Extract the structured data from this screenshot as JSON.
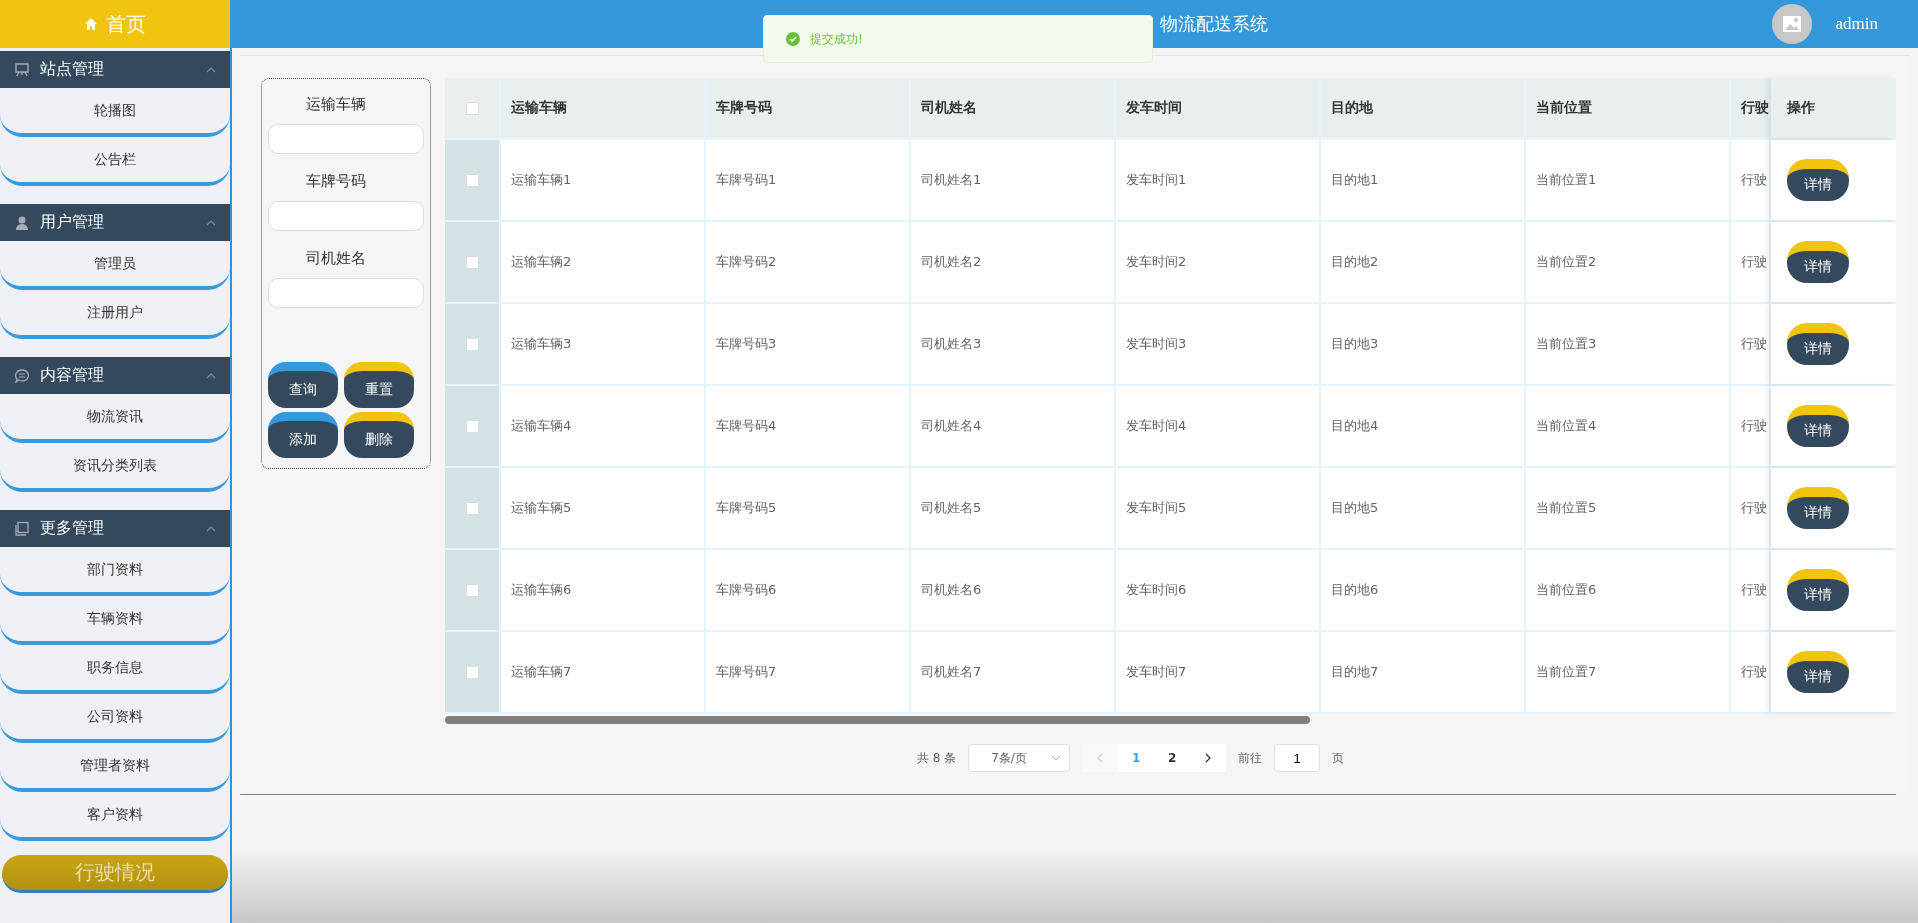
{
  "header": {
    "home": "首页",
    "title": "物流配送系统",
    "user": "admin"
  },
  "toast": {
    "message": "提交成功!"
  },
  "sidebar": {
    "groups": [
      {
        "title": "站点管理",
        "expanded": true,
        "items": [
          "轮播图",
          "公告栏"
        ]
      },
      {
        "title": "用户管理",
        "expanded": true,
        "items": [
          "管理员",
          "注册用户"
        ]
      },
      {
        "title": "内容管理",
        "expanded": true,
        "items": [
          "物流资讯",
          "资讯分类列表"
        ]
      },
      {
        "title": "更多管理",
        "expanded": true,
        "items": [
          "部门资料",
          "车辆资料",
          "职务信息",
          "公司资料",
          "管理者资料",
          "客户资料"
        ]
      }
    ],
    "footer_button": "行驶情况"
  },
  "filters": [
    {
      "label": "运输车辆"
    },
    {
      "label": "车牌号码"
    },
    {
      "label": "司机姓名"
    }
  ],
  "filter_buttons": [
    {
      "label": "查询",
      "color": "#3498db"
    },
    {
      "label": "重置",
      "color": "#f1c40f"
    },
    {
      "label": "添加",
      "color": "#3498db"
    },
    {
      "label": "删除",
      "color": "#f1c40f"
    }
  ],
  "table": {
    "columns": [
      "运输车辆",
      "车牌号码",
      "司机姓名",
      "发车时间",
      "目的地",
      "当前位置",
      "行驶"
    ],
    "action_column": "操作",
    "all_checked": false,
    "rows": [
      {
        "checked": false,
        "cells": [
          "运输车辆1",
          "车牌号码1",
          "司机姓名1",
          "发车时间1",
          "目的地1",
          "当前位置1",
          "行驶"
        ],
        "action": "详情"
      },
      {
        "checked": false,
        "cells": [
          "运输车辆2",
          "车牌号码2",
          "司机姓名2",
          "发车时间2",
          "目的地2",
          "当前位置2",
          "行驶"
        ],
        "action": "详情"
      },
      {
        "checked": false,
        "cells": [
          "运输车辆3",
          "车牌号码3",
          "司机姓名3",
          "发车时间3",
          "目的地3",
          "当前位置3",
          "行驶"
        ],
        "action": "详情"
      },
      {
        "checked": false,
        "cells": [
          "运输车辆4",
          "车牌号码4",
          "司机姓名4",
          "发车时间4",
          "目的地4",
          "当前位置4",
          "行驶"
        ],
        "action": "详情"
      },
      {
        "checked": false,
        "cells": [
          "运输车辆5",
          "车牌号码5",
          "司机姓名5",
          "发车时间5",
          "目的地5",
          "当前位置5",
          "行驶"
        ],
        "action": "详情"
      },
      {
        "checked": false,
        "cells": [
          "运输车辆6",
          "车牌号码6",
          "司机姓名6",
          "发车时间6",
          "目的地6",
          "当前位置6",
          "行驶"
        ],
        "action": "详情"
      },
      {
        "checked": false,
        "cells": [
          "运输车辆7",
          "车牌号码7",
          "司机姓名7",
          "发车时间7",
          "目的地7",
          "当前位置7",
          "行驶"
        ],
        "action": "详情"
      }
    ]
  },
  "pagination": {
    "total": "共 8 条",
    "page_size": "7条/页",
    "pages": [
      {
        "label": "1",
        "selected": true
      },
      {
        "label": "2",
        "selected": false
      }
    ],
    "goto_label": "前往",
    "goto_value": "1",
    "page_unit": "页"
  }
}
